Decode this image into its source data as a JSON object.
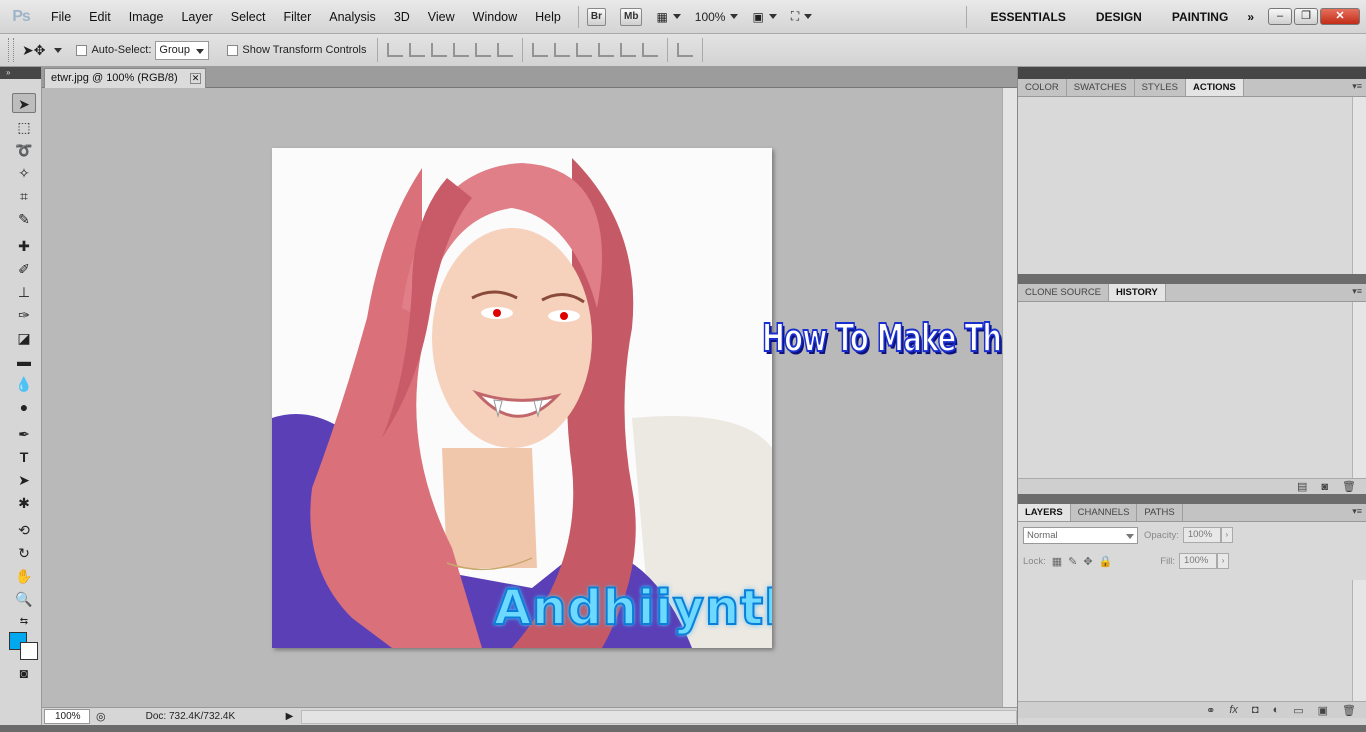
{
  "app": {
    "logo": "Ps"
  },
  "menu": [
    "File",
    "Edit",
    "Image",
    "Layer",
    "Select",
    "Filter",
    "Analysis",
    "3D",
    "View",
    "Window",
    "Help"
  ],
  "appbar": {
    "bridge": "Br",
    "mini_bridge": "Mb",
    "zoom": "100%"
  },
  "workspaces": [
    "ESSENTIALS",
    "DESIGN",
    "PAINTING"
  ],
  "options": {
    "auto_select_label": "Auto-Select:",
    "auto_select_value": "Group",
    "transform_label": "Show Transform Controls"
  },
  "document": {
    "tab_title": "etwr.jpg @ 100% (RGB/8)",
    "watermark_text": "Andhiiynth",
    "caption_text": "How To Make This >????<"
  },
  "colors": {
    "foreground": "#00a8f0",
    "background": "#ffffff"
  },
  "status": {
    "zoom": "100%",
    "doc_info": "Doc: 732.4K/732.4K"
  },
  "panels": {
    "top_tabs": [
      "COLOR",
      "SWATCHES",
      "STYLES",
      "ACTIONS"
    ],
    "top_active": "ACTIONS",
    "middle_tabs": [
      "CLONE SOURCE",
      "HISTORY"
    ],
    "middle_active": "HISTORY",
    "bottom_tabs": [
      "LAYERS",
      "CHANNELS",
      "PATHS"
    ],
    "bottom_active": "LAYERS"
  },
  "layers": {
    "blend_mode": "Normal",
    "opacity_label": "Opacity:",
    "opacity_value": "100%",
    "lock_label": "Lock:",
    "fill_label": "Fill:",
    "fill_value": "100%"
  }
}
